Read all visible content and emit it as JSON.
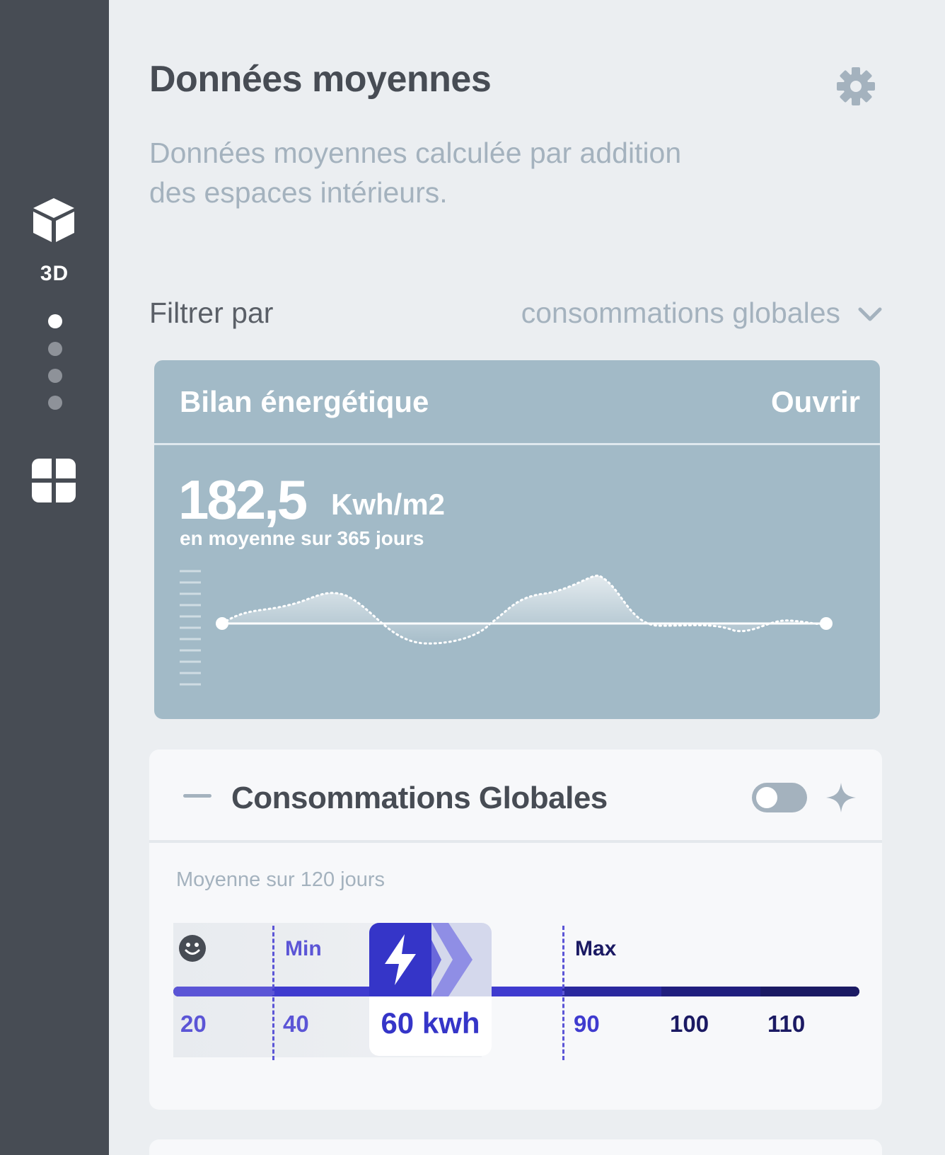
{
  "sidebar": {
    "mode_label": "3D",
    "icons": [
      "cube-icon",
      "grid-icon"
    ],
    "pagination": {
      "count": 4,
      "active": 0
    }
  },
  "header": {
    "title": "Données moyennes",
    "subtitle_line1": "Données moyennes calculée par addition",
    "subtitle_line2": "des espaces intérieurs.",
    "settings_icon": "gear-icon"
  },
  "filter": {
    "label": "Filtrer par",
    "selected": "consommations globales"
  },
  "bilan": {
    "title": "Bilan énergétique",
    "open_label": "Ouvrir",
    "value": "182,5",
    "unit": "Kwh/m2",
    "caption": "en moyenne sur 365 jours",
    "background": "#a2bac7"
  },
  "consommations": {
    "title": "Consommations Globales",
    "toggle_on": false,
    "range_caption": "Moyenne sur 120 jours",
    "min_label": "Min",
    "max_label": "Max",
    "ticks": [
      "20",
      "40",
      "90",
      "100",
      "110"
    ],
    "current_value": "60 kwh",
    "colors": {
      "accent": "#3535c8",
      "dark": "#1b1a63",
      "light": "#5b55d6"
    }
  }
}
